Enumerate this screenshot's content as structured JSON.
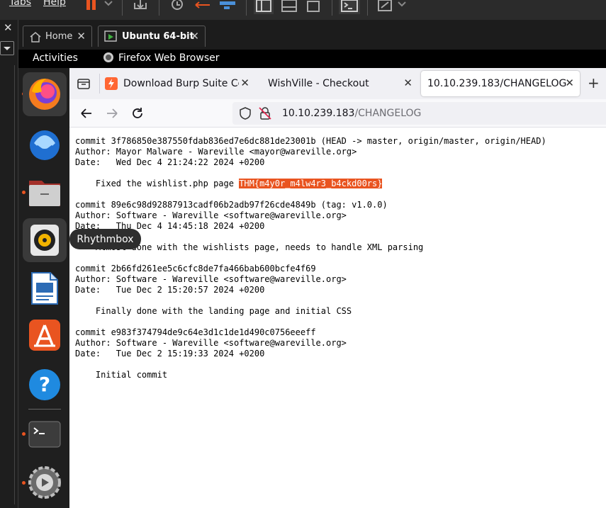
{
  "host": {
    "menu": [
      "Tabs",
      "Help"
    ],
    "vm_tabs": [
      {
        "label": "Home",
        "active": false
      },
      {
        "label": "Ubuntu 64-bit",
        "active": true
      }
    ]
  },
  "gnome": {
    "activities": "Activities",
    "app_name": "Firefox Web Browser"
  },
  "dock": {
    "items": [
      "firefox",
      "thunderbird",
      "files",
      "rhythmbox",
      "libreoffice-writer",
      "app-center",
      "help",
      "terminal",
      "settings"
    ],
    "tooltip": "Rhythmbox"
  },
  "browser": {
    "tabs": [
      {
        "title": "Download Burp Suite Con"
      },
      {
        "title": "WishVille - Checkout"
      },
      {
        "title": "10.10.239.183/CHANGELOG"
      }
    ],
    "url": {
      "host": "10.10.239.183",
      "path": "/CHANGELOG"
    }
  },
  "changelog": {
    "commits": [
      {
        "commit": "commit 3f786850e387550fdab836ed7e6dc881de23001b (HEAD -> master, origin/master, origin/HEAD)",
        "author": "Author: Mayor Malware - Wareville <mayor@wareville.org>",
        "date": "Date:   Wed Dec 4 21:24:22 2024 +0200",
        "message": "    Fixed the wishlist.php page ",
        "flag": "THM{m4y0r_m4lw4r3_b4ckd00rs}"
      },
      {
        "commit": "commit 89e6c98d92887913cadf06b2adb97f26cde4849b (tag: v1.0.0)",
        "author": "Author: Software - Wareville <software@wareville.org>",
        "date": "Date:   Thu Dec 4 14:45:18 2024 +0200",
        "message": "    Almost done with the wishlists page, needs to handle XML parsing"
      },
      {
        "commit": "commit 2b66fd261ee5c6cfc8de7fa466bab600bcfe4f69",
        "author": "Author: Software - Wareville <software@wareville.org>",
        "date": "Date:   Tue Dec 2 15:20:57 2024 +0200",
        "message": "    Finally done with the landing page and initial CSS"
      },
      {
        "commit": "commit e983f374794de9c64e3d1c1de1d490c0756eeeff",
        "author": "Author: Software - Wareville <software@wareville.org>",
        "date": "Date:   Tue Dec 2 15:19:33 2024 +0200",
        "message": "    Initial commit"
      }
    ]
  }
}
